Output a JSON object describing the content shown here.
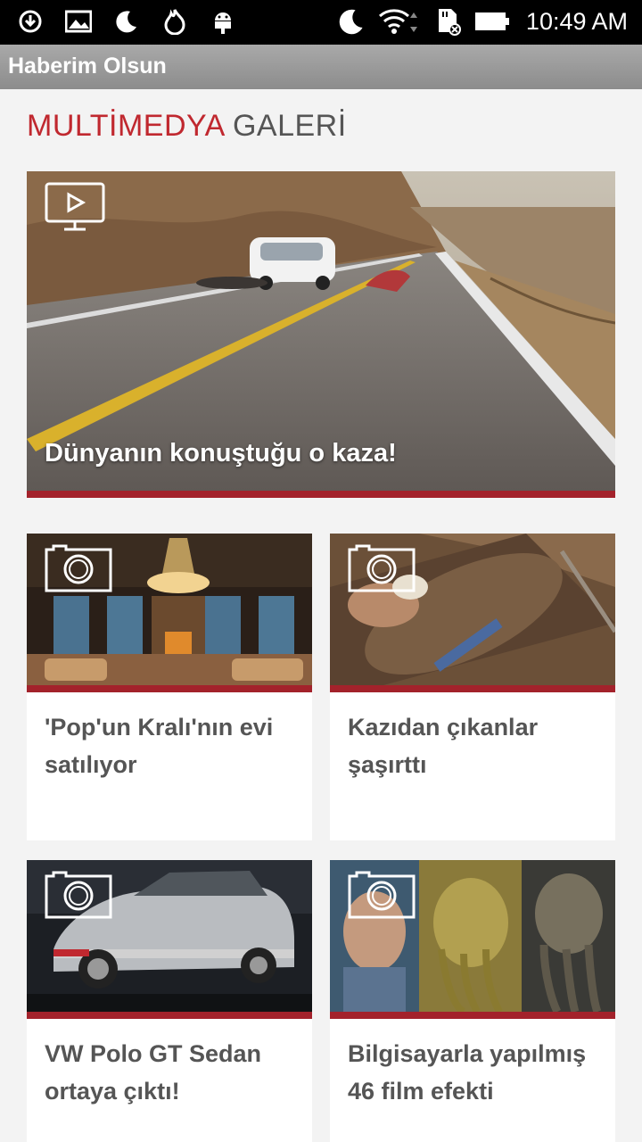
{
  "status_bar": {
    "time": "10:49 AM",
    "left_icons": [
      "sync-icon",
      "image-icon",
      "moon-icon",
      "flame-icon",
      "android-icon"
    ],
    "right_icons": [
      "moon-icon",
      "wifi-icon",
      "sd-card-icon",
      "battery-icon"
    ]
  },
  "app_bar": {
    "title": "Haberim Olsun"
  },
  "section": {
    "title_red": "MULTİMEDYA",
    "title_gray": "GALERİ"
  },
  "featured": {
    "caption": "Dünyanın konuştuğu o kaza!",
    "media_type": "video-icon"
  },
  "cards": [
    {
      "title": "'Pop'un Kralı'nın evi satılıyor",
      "media_type": "camera-icon"
    },
    {
      "title": "Kazıdan çıkanlar şaşırttı",
      "media_type": "camera-icon"
    },
    {
      "title": "VW Polo GT Sedan ortaya çıktı!",
      "media_type": "camera-icon"
    },
    {
      "title": "Bilgisayarla yapılmış 46 film efekti",
      "media_type": "camera-icon"
    }
  ],
  "colors": {
    "accent_red": "#c0282f",
    "bar_red": "#a3222b",
    "app_bar_gray": "#9a9a9a"
  }
}
